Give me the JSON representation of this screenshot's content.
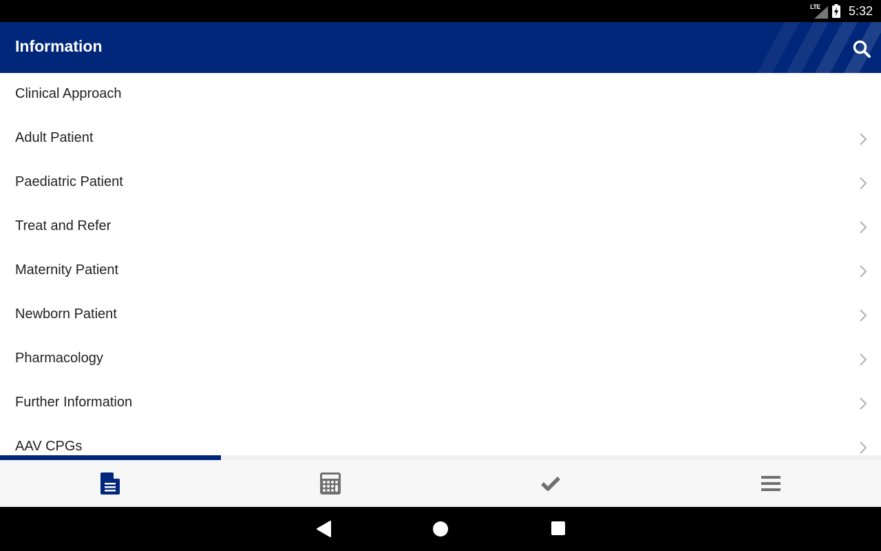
{
  "status_bar": {
    "network": "LTE",
    "time": "5:32"
  },
  "app_bar": {
    "title": "Information",
    "search_icon": "search-icon"
  },
  "list": {
    "items": [
      {
        "label": "Clinical Approach",
        "has_chevron": false
      },
      {
        "label": "Adult Patient",
        "has_chevron": true
      },
      {
        "label": "Paediatric Patient",
        "has_chevron": true
      },
      {
        "label": "Treat and Refer",
        "has_chevron": true
      },
      {
        "label": "Maternity Patient",
        "has_chevron": true
      },
      {
        "label": "Newborn Patient",
        "has_chevron": true
      },
      {
        "label": "Pharmacology",
        "has_chevron": true
      },
      {
        "label": "Further Information",
        "has_chevron": true
      },
      {
        "label": "AAV CPGs",
        "has_chevron": true
      }
    ]
  },
  "bottom_nav": {
    "active_index": 0,
    "tabs": [
      {
        "icon": "document-icon"
      },
      {
        "icon": "calculator-icon"
      },
      {
        "icon": "checkmark-icon"
      },
      {
        "icon": "menu-icon"
      }
    ],
    "indicator_fraction": 0.25
  },
  "colors": {
    "brand": "#00277a",
    "inactive_icon": "#707070",
    "chevron": "#b0b0b0"
  }
}
